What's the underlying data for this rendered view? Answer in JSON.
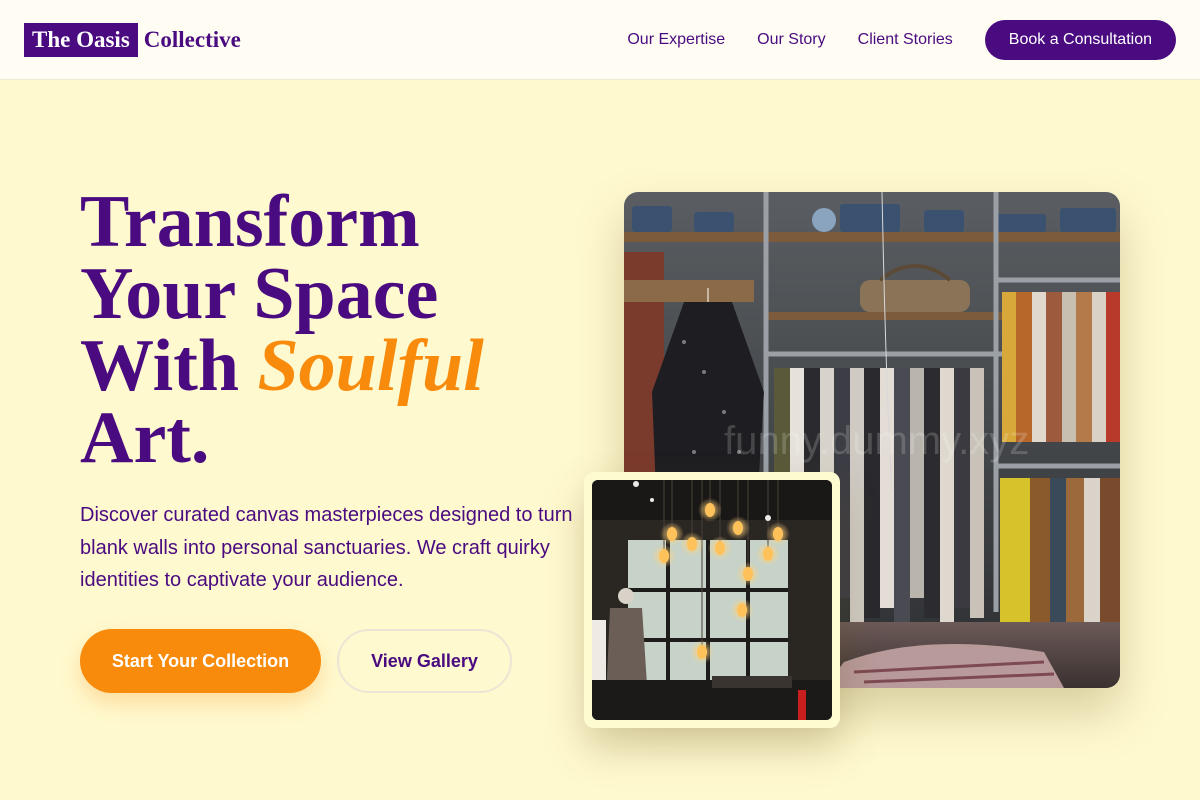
{
  "brand": {
    "logo_box_text": "The Oasis",
    "logo_text": "Collective"
  },
  "nav": {
    "links": [
      "Our Expertise",
      "Our Story",
      "Client Stories"
    ],
    "cta": "Book a Consultation"
  },
  "hero": {
    "headline_line1": "Transform",
    "headline_line2": "Your Space",
    "headline_line3_prefix": "With ",
    "headline_accent": "Soulful",
    "headline_line4": "Art.",
    "description": "Discover curated canvas masterpieces designed to turn blank walls into personal sanctuaries. We craft quirky identities to captivate your audience.",
    "primary_button": "Start Your Collection",
    "secondary_button": "View Gallery"
  },
  "images": {
    "main_watermark": "funny.dummy.xyz"
  },
  "colors": {
    "primary": "#4a0a80",
    "accent": "#f88a0c",
    "background": "#fff9cf",
    "header_bg": "#fffdf3"
  }
}
